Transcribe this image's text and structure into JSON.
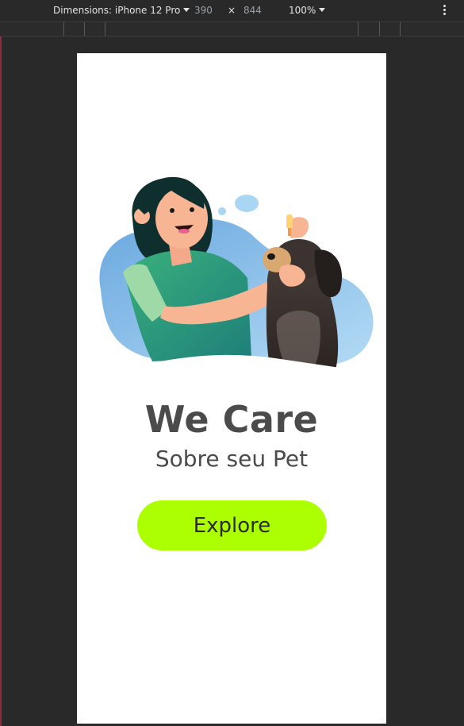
{
  "devtools": {
    "device_label": "Dimensions: iPhone 12 Pro",
    "width": "390",
    "times": "×",
    "height": "844",
    "zoom": "100%"
  },
  "app": {
    "headline": "We Care",
    "subheadline": "Sobre seu Pet",
    "explore_label": "Explore"
  },
  "colors": {
    "accent": "#acff00",
    "text": "#4b4b4b",
    "blob_blue": "#7fb8e6"
  }
}
